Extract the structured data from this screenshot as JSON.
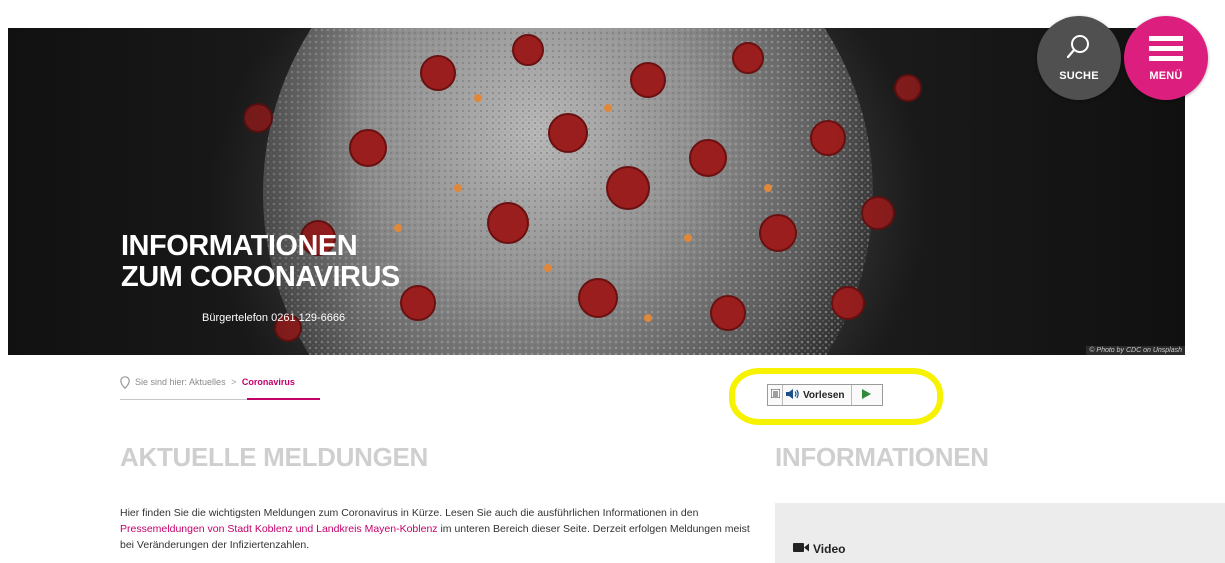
{
  "hero": {
    "title_line1": "INFORMATIONEN",
    "title_line2": "ZUM CORONAVIRUS",
    "phone": "Bürgertelefon 0261 129-6666",
    "photo_credit": "© Photo by CDC on Unsplash"
  },
  "header": {
    "search_label": "SUCHE",
    "menu_label": "MENÜ",
    "search_icon": "search-icon",
    "menu_icon": "hamburger-icon",
    "menu_color": "#dc1f7e",
    "search_color": "#505050"
  },
  "breadcrumb": {
    "prefix": "Sie sind hier:",
    "parent": "Aktuelles",
    "separator": ">",
    "current": "Coronavirus"
  },
  "readspeaker": {
    "listen_label": "Vorlesen"
  },
  "main": {
    "heading": "AKTUELLE MELDUNGEN",
    "intro_part1": "Hier finden Sie die wichtigsten Meldungen zum Coronavirus in Kürze. Lesen Sie auch die ausführlichen Informationen in den ",
    "intro_link": "Pressemeldungen von Stadt Koblenz und Landkreis Mayen-Koblenz",
    "intro_part2": " im unteren Bereich dieser Seite. Derzeit erfolgen Meldungen meist bei Veränderungen der Infiziertenzahlen."
  },
  "sidebar": {
    "heading": "INFORMATIONEN",
    "video_label": "Video"
  },
  "colors": {
    "accent": "#c4006b",
    "highlight": "#f6f200",
    "heading_gray": "#cfcfcf"
  }
}
